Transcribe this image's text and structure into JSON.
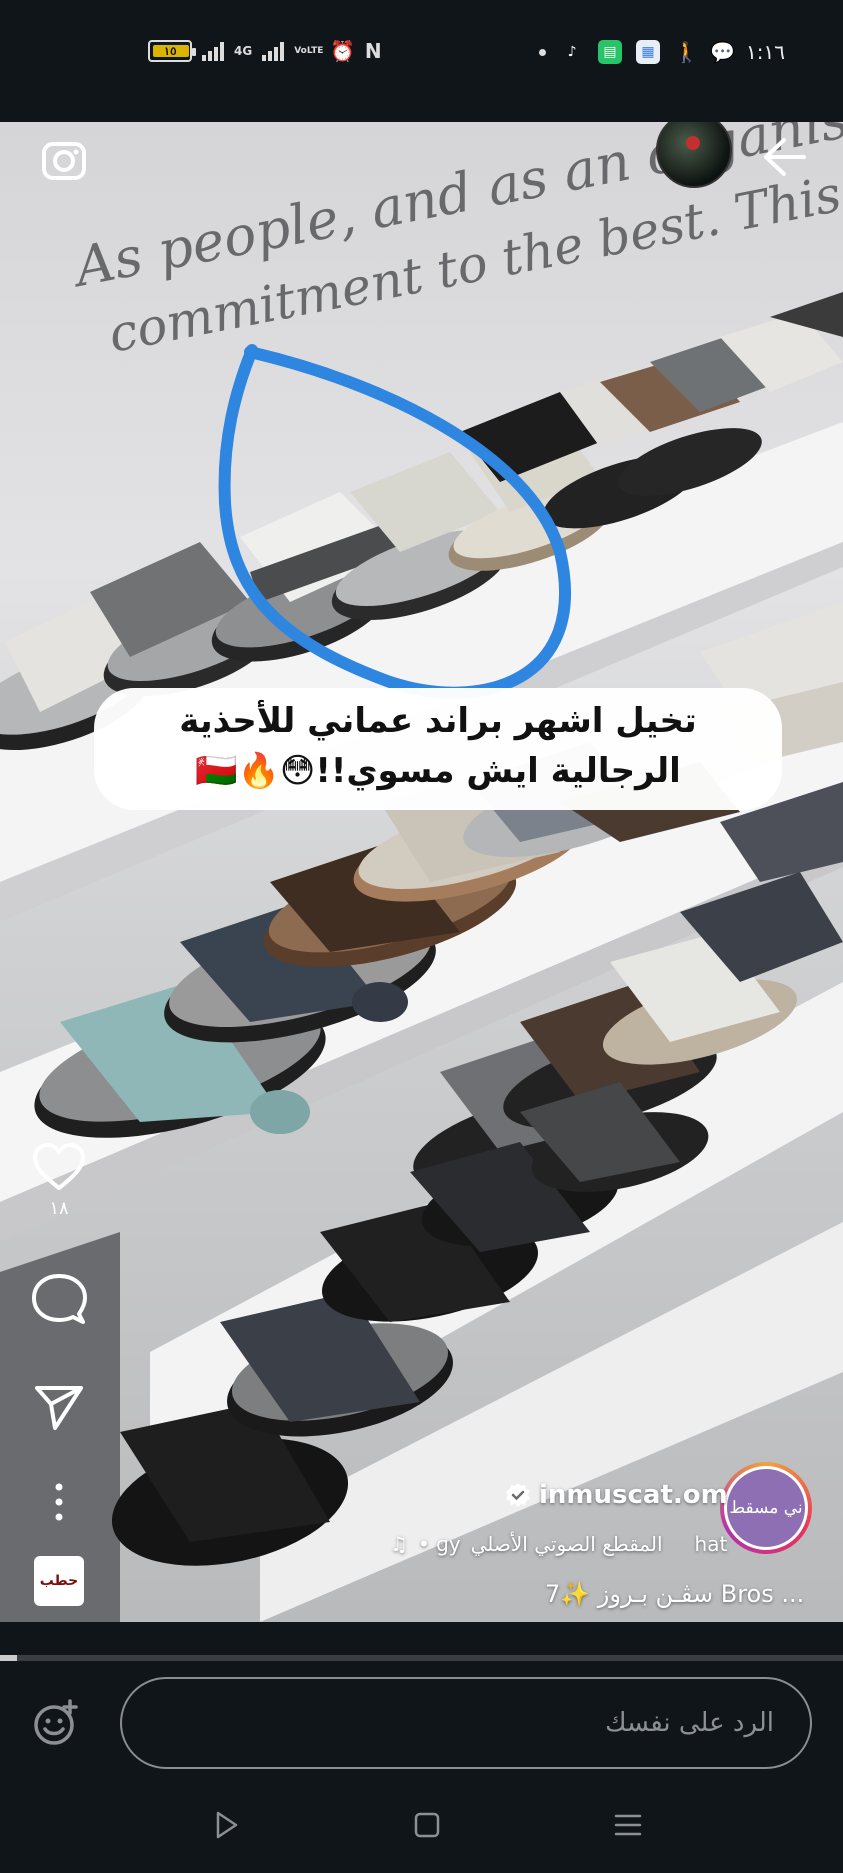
{
  "status_bar": {
    "battery_level": "١٥",
    "network_4g": "4G",
    "volte": "VoLTE",
    "time": "١:١٦",
    "icons": [
      "battery-icon",
      "signal-icon",
      "signal-icon",
      "volte-icon",
      "alarm-icon",
      "nfc-icon",
      "dot-icon",
      "tiktok-icon",
      "app-icon",
      "app-icon",
      "accessibility-icon",
      "chat-icon"
    ]
  },
  "story": {
    "wall_text_line1": "As people, and as an organisation, we are driven by",
    "wall_text_line2": "commitment to the best. This is the spirit that has sup",
    "caption_line1": "تخيل اشهر براند عماني للأحذية",
    "caption_line2": "الرجالية ايش مسوي!!😳🔥🇴🇲",
    "likes_count": "١٨",
    "account_name": "inmuscat.om",
    "avatar_text": "ني مسقط",
    "audio_title": "المقطع الصوتي الأصلي",
    "audio_prefix": "hat",
    "audio_suffix": "• ɡy",
    "description": "سڤـن بـروز ✨7 Bros ...",
    "music_thumb_text": "حطب",
    "progress": 0.02
  },
  "reply": {
    "placeholder": "الرد على نفسك"
  },
  "colors": {
    "background": "#10151a",
    "annotation_circle": "#2f86e0",
    "avatar_ring": "#e7335c"
  }
}
